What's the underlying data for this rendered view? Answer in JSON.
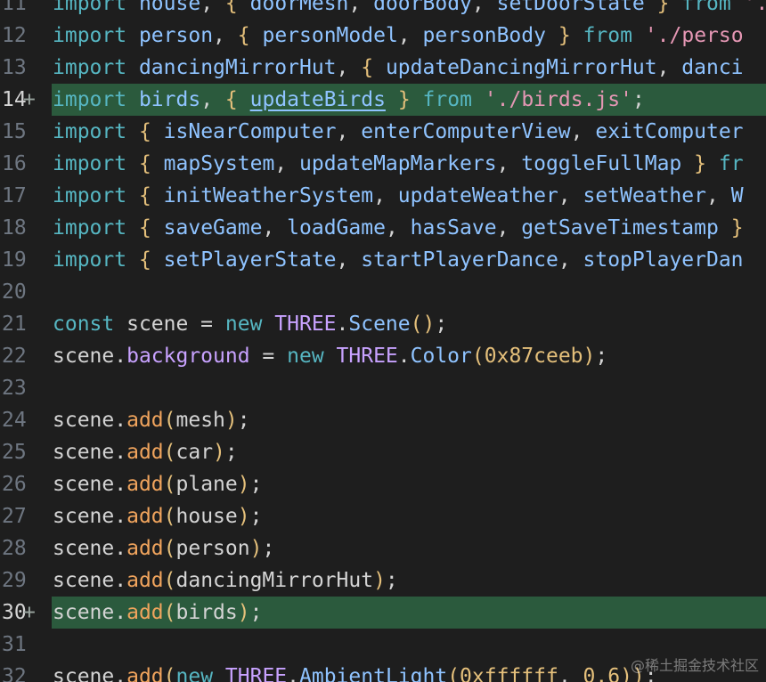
{
  "editor": {
    "lines": [
      {
        "n": "11",
        "added": false,
        "tokens": [
          [
            "kw",
            "import"
          ],
          [
            "pl",
            " "
          ],
          [
            "id",
            "house"
          ],
          [
            "pl",
            ", "
          ],
          [
            "br",
            "{"
          ],
          [
            "pl",
            " "
          ],
          [
            "id",
            "doorMesh"
          ],
          [
            "pl",
            ", "
          ],
          [
            "id",
            "doorBody"
          ],
          [
            "pl",
            ", "
          ],
          [
            "id",
            "setDoorState"
          ],
          [
            "pl",
            " "
          ],
          [
            "br",
            "}"
          ],
          [
            "pl",
            " "
          ],
          [
            "kw",
            "from"
          ],
          [
            "pl",
            " "
          ],
          [
            "str",
            "'./house.js'"
          ]
        ]
      },
      {
        "n": "12",
        "added": false,
        "tokens": [
          [
            "kw",
            "import"
          ],
          [
            "pl",
            " "
          ],
          [
            "id",
            "person"
          ],
          [
            "pl",
            ", "
          ],
          [
            "br",
            "{"
          ],
          [
            "pl",
            " "
          ],
          [
            "id",
            "personModel"
          ],
          [
            "pl",
            ", "
          ],
          [
            "id",
            "personBody"
          ],
          [
            "pl",
            " "
          ],
          [
            "br",
            "}"
          ],
          [
            "pl",
            " "
          ],
          [
            "kw",
            "from"
          ],
          [
            "pl",
            " "
          ],
          [
            "str",
            "'./perso"
          ]
        ]
      },
      {
        "n": "13",
        "added": false,
        "tokens": [
          [
            "kw",
            "import"
          ],
          [
            "pl",
            " "
          ],
          [
            "id",
            "dancingMirrorHut"
          ],
          [
            "pl",
            ", "
          ],
          [
            "br",
            "{"
          ],
          [
            "pl",
            " "
          ],
          [
            "id",
            "updateDancingMirrorHut"
          ],
          [
            "pl",
            ", "
          ],
          [
            "id",
            "danci"
          ]
        ]
      },
      {
        "n": "14",
        "added": true,
        "tokens": [
          [
            "kw",
            "import"
          ],
          [
            "pl",
            " "
          ],
          [
            "id",
            "birds"
          ],
          [
            "pl",
            ", "
          ],
          [
            "br",
            "{"
          ],
          [
            "pl",
            " "
          ],
          [
            "id ul",
            "updateBirds"
          ],
          [
            "pl",
            " "
          ],
          [
            "br",
            "}"
          ],
          [
            "pl",
            " "
          ],
          [
            "kw",
            "from"
          ],
          [
            "pl",
            " "
          ],
          [
            "str",
            "'./birds.js'"
          ],
          [
            "pl",
            ";"
          ]
        ]
      },
      {
        "n": "15",
        "added": false,
        "tokens": [
          [
            "kw",
            "import"
          ],
          [
            "pl",
            " "
          ],
          [
            "br",
            "{"
          ],
          [
            "pl",
            " "
          ],
          [
            "id",
            "isNearComputer"
          ],
          [
            "pl",
            ", "
          ],
          [
            "id",
            "enterComputerView"
          ],
          [
            "pl",
            ", "
          ],
          [
            "id",
            "exitComputer"
          ]
        ]
      },
      {
        "n": "16",
        "added": false,
        "tokens": [
          [
            "kw",
            "import"
          ],
          [
            "pl",
            " "
          ],
          [
            "br",
            "{"
          ],
          [
            "pl",
            " "
          ],
          [
            "id",
            "mapSystem"
          ],
          [
            "pl",
            ", "
          ],
          [
            "id",
            "updateMapMarkers"
          ],
          [
            "pl",
            ", "
          ],
          [
            "id",
            "toggleFullMap"
          ],
          [
            "pl",
            " "
          ],
          [
            "br",
            "}"
          ],
          [
            "pl",
            " "
          ],
          [
            "kw",
            "fr"
          ]
        ]
      },
      {
        "n": "17",
        "added": false,
        "tokens": [
          [
            "kw",
            "import"
          ],
          [
            "pl",
            " "
          ],
          [
            "br",
            "{"
          ],
          [
            "pl",
            " "
          ],
          [
            "id",
            "initWeatherSystem"
          ],
          [
            "pl",
            ", "
          ],
          [
            "id",
            "updateWeather"
          ],
          [
            "pl",
            ", "
          ],
          [
            "id",
            "setWeather"
          ],
          [
            "pl",
            ", "
          ],
          [
            "id",
            "W"
          ]
        ]
      },
      {
        "n": "18",
        "added": false,
        "tokens": [
          [
            "kw",
            "import"
          ],
          [
            "pl",
            " "
          ],
          [
            "br",
            "{"
          ],
          [
            "pl",
            " "
          ],
          [
            "id",
            "saveGame"
          ],
          [
            "pl",
            ", "
          ],
          [
            "id",
            "loadGame"
          ],
          [
            "pl",
            ", "
          ],
          [
            "id",
            "hasSave"
          ],
          [
            "pl",
            ", "
          ],
          [
            "id",
            "getSaveTimestamp"
          ],
          [
            "pl",
            " "
          ],
          [
            "br",
            "}"
          ]
        ]
      },
      {
        "n": "19",
        "added": false,
        "tokens": [
          [
            "kw",
            "import"
          ],
          [
            "pl",
            " "
          ],
          [
            "br",
            "{"
          ],
          [
            "pl",
            " "
          ],
          [
            "id",
            "setPlayerState"
          ],
          [
            "pl",
            ", "
          ],
          [
            "id",
            "startPlayerDance"
          ],
          [
            "pl",
            ", "
          ],
          [
            "id",
            "stopPlayerDan"
          ]
        ]
      },
      {
        "n": "20",
        "added": false,
        "tokens": []
      },
      {
        "n": "21",
        "added": false,
        "tokens": [
          [
            "kw",
            "const"
          ],
          [
            "pl",
            " scene = "
          ],
          [
            "kw",
            "new"
          ],
          [
            "pl",
            " "
          ],
          [
            "cls",
            "THREE"
          ],
          [
            "pl",
            "."
          ],
          [
            "id",
            "Scene"
          ],
          [
            "pa",
            "()"
          ],
          [
            "pl",
            ";"
          ]
        ]
      },
      {
        "n": "22",
        "added": false,
        "tokens": [
          [
            "pl",
            "scene."
          ],
          [
            "cls",
            "background"
          ],
          [
            "pl",
            " = "
          ],
          [
            "kw",
            "new"
          ],
          [
            "pl",
            " "
          ],
          [
            "cls",
            "THREE"
          ],
          [
            "pl",
            "."
          ],
          [
            "id",
            "Color"
          ],
          [
            "pa",
            "("
          ],
          [
            "num",
            "0x87ceeb"
          ],
          [
            "pa",
            ")"
          ],
          [
            "pl",
            ";"
          ]
        ]
      },
      {
        "n": "23",
        "added": false,
        "tokens": []
      },
      {
        "n": "24",
        "added": false,
        "tokens": [
          [
            "pl",
            "scene."
          ],
          [
            "fn",
            "add"
          ],
          [
            "pa",
            "("
          ],
          [
            "pl",
            "mesh"
          ],
          [
            "pa",
            ")"
          ],
          [
            "pl",
            ";"
          ]
        ]
      },
      {
        "n": "25",
        "added": false,
        "tokens": [
          [
            "pl",
            "scene."
          ],
          [
            "fn",
            "add"
          ],
          [
            "pa",
            "("
          ],
          [
            "pl",
            "car"
          ],
          [
            "pa",
            ")"
          ],
          [
            "pl",
            ";"
          ]
        ]
      },
      {
        "n": "26",
        "added": false,
        "tokens": [
          [
            "pl",
            "scene."
          ],
          [
            "fn",
            "add"
          ],
          [
            "pa",
            "("
          ],
          [
            "pl",
            "plane"
          ],
          [
            "pa",
            ")"
          ],
          [
            "pl",
            ";"
          ]
        ]
      },
      {
        "n": "27",
        "added": false,
        "tokens": [
          [
            "pl",
            "scene."
          ],
          [
            "fn",
            "add"
          ],
          [
            "pa",
            "("
          ],
          [
            "pl",
            "house"
          ],
          [
            "pa",
            ")"
          ],
          [
            "pl",
            ";"
          ]
        ]
      },
      {
        "n": "28",
        "added": false,
        "tokens": [
          [
            "pl",
            "scene."
          ],
          [
            "fn",
            "add"
          ],
          [
            "pa",
            "("
          ],
          [
            "pl",
            "person"
          ],
          [
            "pa",
            ")"
          ],
          [
            "pl",
            ";"
          ]
        ]
      },
      {
        "n": "29",
        "added": false,
        "tokens": [
          [
            "pl",
            "scene."
          ],
          [
            "fn",
            "add"
          ],
          [
            "pa",
            "("
          ],
          [
            "pl",
            "dancingMirrorHut"
          ],
          [
            "pa",
            ")"
          ],
          [
            "pl",
            ";"
          ]
        ]
      },
      {
        "n": "30",
        "added": true,
        "tokens": [
          [
            "pl",
            "scene."
          ],
          [
            "fn",
            "add"
          ],
          [
            "pa",
            "("
          ],
          [
            "pl",
            "birds"
          ],
          [
            "pa",
            ")"
          ],
          [
            "pl",
            ";"
          ]
        ]
      },
      {
        "n": "31",
        "added": false,
        "tokens": []
      },
      {
        "n": "32",
        "added": false,
        "tokens": [
          [
            "pl",
            "scene."
          ],
          [
            "fn",
            "add"
          ],
          [
            "pa",
            "("
          ],
          [
            "kw",
            "new"
          ],
          [
            "pl",
            " "
          ],
          [
            "cls",
            "THREE"
          ],
          [
            "pl",
            "."
          ],
          [
            "id",
            "AmbientLight"
          ],
          [
            "pa",
            "("
          ],
          [
            "num",
            "0xffffff"
          ],
          [
            "pl",
            ", "
          ],
          [
            "num",
            "0.6"
          ],
          [
            "pa",
            "))"
          ],
          [
            "pl",
            ";"
          ]
        ]
      }
    ],
    "added_marker": "+"
  },
  "watermark": "@稀土掘金技术社区",
  "colors": {
    "background": "#1e1e1e",
    "added_line": "#2b5a3d"
  }
}
